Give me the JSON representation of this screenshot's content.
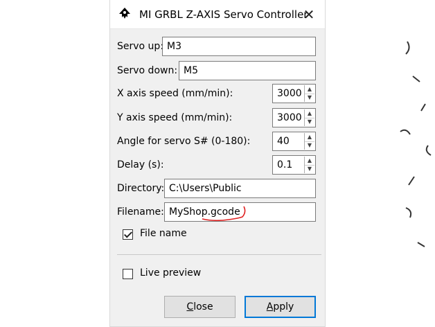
{
  "window": {
    "title": "MI GRBL Z-AXIS Servo Controller",
    "close_glyph": "✕"
  },
  "fields": {
    "servo_up": {
      "label": "Servo up:",
      "value": "M3"
    },
    "servo_down": {
      "label": "Servo down:",
      "value": "M5"
    },
    "x_speed": {
      "label": "X axis speed (mm/min):",
      "value": "3000"
    },
    "y_speed": {
      "label": "Y axis speed (mm/min):",
      "value": "3000"
    },
    "servo_angle": {
      "label": "Angle for servo S# (0-180):",
      "value": "40"
    },
    "delay": {
      "label": "Delay (s):",
      "value": "0.1"
    },
    "directory": {
      "label": "Directory:",
      "value": "C:\\Users\\Public"
    },
    "filename": {
      "label": "Filename:",
      "value": "MyShop.gcode"
    }
  },
  "checkboxes": {
    "file_name": {
      "label": "File name",
      "checked": true
    },
    "live_preview": {
      "label": "Live preview",
      "checked": false
    }
  },
  "buttons": {
    "close": {
      "label_mnemonic": "C",
      "label_rest": "lose"
    },
    "apply": {
      "label_mnemonic": "A",
      "label_rest": "pply"
    }
  },
  "colors": {
    "default_button_border": "#0078d7",
    "annotation": "#e02020"
  },
  "icons": {
    "app": "inkscape-logo-icon",
    "close": "close-icon",
    "spin_up": "triangle-up-icon",
    "spin_down": "triangle-down-icon"
  }
}
